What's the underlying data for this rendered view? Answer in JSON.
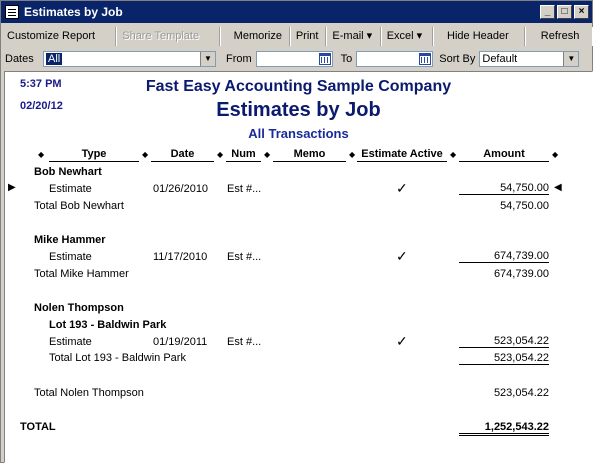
{
  "window": {
    "title": "Estimates by Job"
  },
  "toolbar": {
    "customize": "Customize Report",
    "share": "Share Template",
    "memorize": "Memorize",
    "print": "Print",
    "email": "E-mail ▾",
    "excel": "Excel ▾",
    "hide_header": "Hide Header",
    "refresh": "Refresh"
  },
  "filters": {
    "dates_label": "Dates",
    "dates_value": "All",
    "from_label": "From",
    "from_value": "",
    "to_label": "To",
    "to_value": "",
    "sortby_label": "Sort By",
    "sortby_value": "Default"
  },
  "report": {
    "time": "5:37 PM",
    "date": "02/20/12",
    "company": "Fast Easy Accounting Sample Company",
    "title": "Estimates by Job",
    "basis": "All Transactions",
    "columns": [
      "Type",
      "Date",
      "Num",
      "Memo",
      "Estimate Active",
      "Amount"
    ],
    "bob": {
      "name": "Bob Newhart",
      "row": {
        "type": "Estimate",
        "date": "01/26/2010",
        "num": "Est #...",
        "active": "✓",
        "amount": "54,750.00"
      },
      "total_label": "Total Bob Newhart",
      "total": "54,750.00"
    },
    "mike": {
      "name": "Mike Hammer",
      "row": {
        "type": "Estimate",
        "date": "11/17/2010",
        "num": "Est #...",
        "active": "✓",
        "amount": "674,739.00"
      },
      "total_label": "Total Mike Hammer",
      "total": "674,739.00"
    },
    "nolen": {
      "name": "Nolen Thompson",
      "sub": "Lot 193 - Baldwin Park",
      "row": {
        "type": "Estimate",
        "date": "01/19/2011",
        "num": "Est #...",
        "active": "✓",
        "amount": "523,054.22"
      },
      "sub_total_label": "Total Lot 193 - Baldwin Park",
      "sub_total": "523,054.22",
      "total_label": "Total Nolen Thompson",
      "total": "523,054.22"
    },
    "grand_label": "TOTAL",
    "grand_total": "1,252,543.22"
  }
}
